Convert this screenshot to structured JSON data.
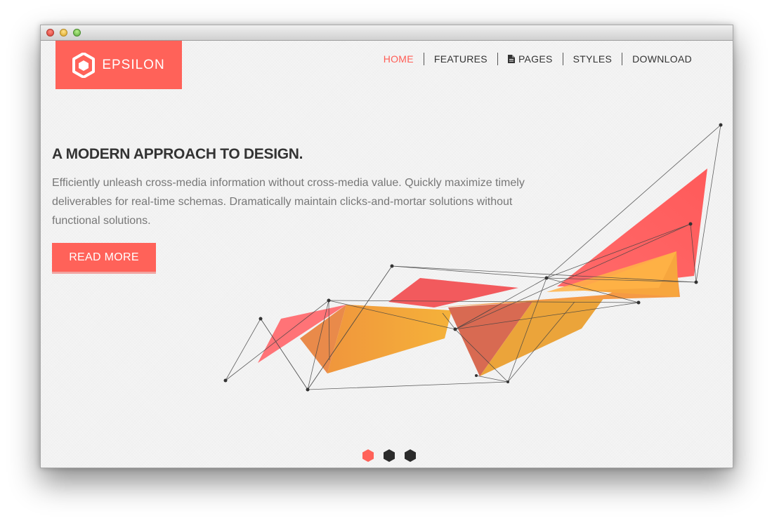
{
  "brand": {
    "name": "EPSILON",
    "color": "#ff6259"
  },
  "nav": {
    "items": [
      {
        "label": "HOME",
        "active": true
      },
      {
        "label": "FEATURES",
        "active": false
      },
      {
        "label": "PAGES",
        "icon": "document-icon",
        "active": false
      },
      {
        "label": "STYLES",
        "active": false
      },
      {
        "label": "DOWNLOAD",
        "active": false
      }
    ]
  },
  "hero": {
    "title": "A MODERN APPROACH TO DESIGN.",
    "text": "Efficiently unleash cross-media information without cross-media value. Quickly maximize timely deliverables for real-time schemas. Dramatically maintain clicks-and-mortar solutions without functional solutions.",
    "cta_label": "READ MORE"
  },
  "slider": {
    "count": 3,
    "active_index": 0,
    "active_color": "#ff6259",
    "inactive_color": "#2b2b2b"
  }
}
